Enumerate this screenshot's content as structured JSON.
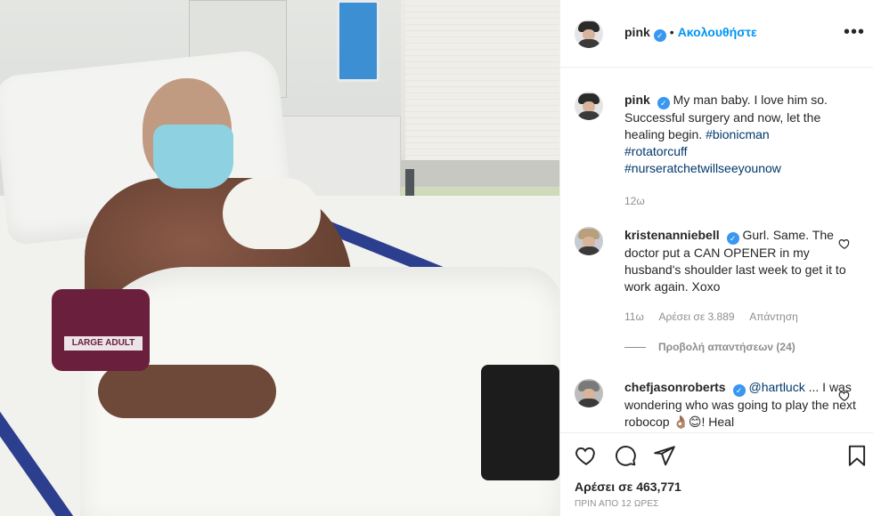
{
  "post": {
    "photo_label": "LARGE ADULT",
    "author": "pink",
    "follow_label": "Ακολουθήστε",
    "separator": "•",
    "more_label": "•••"
  },
  "caption": {
    "username": "pink",
    "text": "My man baby. I love him so. Successful surgery and now, let the healing begin.",
    "hashtags": [
      "#bionicman",
      "#rotatorcuff",
      "#nurseratchetwillseeyounow"
    ],
    "age": "12ω"
  },
  "comments": [
    {
      "username": "kristenanniebell",
      "text": "Gurl. Same. The doctor put a CAN OPENER in my husband's shoulder last week to get it to work again. Xoxo",
      "age": "11ω",
      "likes": "Αρέσει σε 3.889",
      "reply": "Απάντηση",
      "view_replies": "Προβολή απαντήσεων (24)"
    },
    {
      "username": "chefjasonroberts",
      "mention": "@hartluck",
      "text": "... I was wondering who was going to play the next robocop 👌🏽😊! Heal"
    }
  ],
  "footer": {
    "likes": "Αρέσει σε 463,771",
    "date": "ΠΡΙΝ ΑΠΟ 12 ΩΡΕΣ"
  },
  "icons": {
    "like": "heart-icon",
    "comment": "comment-icon",
    "share": "paper-plane-icon",
    "save": "bookmark-icon",
    "verified": "verified-badge-icon"
  },
  "colors": {
    "accent": "#0095f6",
    "verified": "#3897f0",
    "hashtag": "#00376b",
    "muted": "#8e8e8e"
  }
}
